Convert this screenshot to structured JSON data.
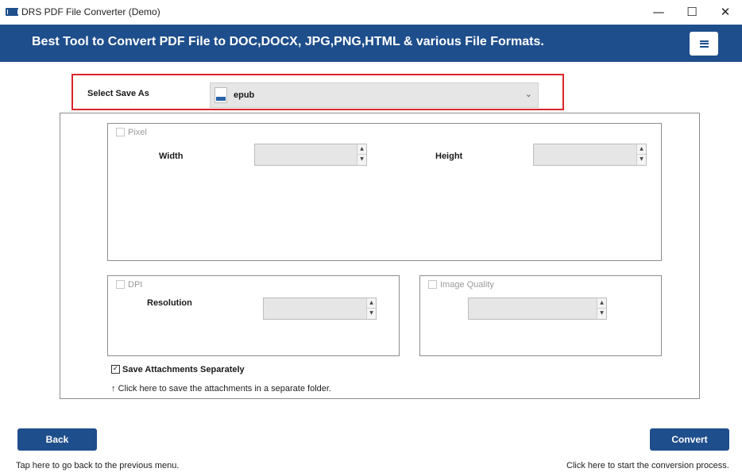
{
  "window": {
    "title": "DRS PDF File Converter (Demo)",
    "minimize": "—",
    "maximize": "☐",
    "close": "✕"
  },
  "banner": {
    "title": "Best Tool to Convert PDF File to DOC,DOCX, JPG,PNG,HTML & various File Formats.",
    "menu_icon": "hamburger-icon"
  },
  "save_as": {
    "label": "Select Save As",
    "selected": "epub",
    "icon": "file-icon",
    "chevron": "⌄"
  },
  "pixel": {
    "checkbox_label": "Pixel",
    "checked": false,
    "width_label": "Width",
    "width_value": "",
    "height_label": "Height",
    "height_value": ""
  },
  "dpi": {
    "checkbox_label": "DPI",
    "checked": false,
    "resolution_label": "Resolution",
    "resolution_value": ""
  },
  "image_quality": {
    "checkbox_label": "Image Quality",
    "checked": false,
    "value": ""
  },
  "attachments": {
    "label": "Save Attachments Separately",
    "checked": true,
    "check_mark": "✓",
    "hint": "↑ Click here to save the attachments in a separate folder."
  },
  "footer": {
    "back_label": "Back",
    "back_hint": "Tap here to go back to the previous menu.",
    "convert_label": "Convert",
    "convert_hint": "Click here to start the conversion process."
  },
  "colors": {
    "accent": "#1f4e8c",
    "highlight_border": "#d9262b"
  }
}
